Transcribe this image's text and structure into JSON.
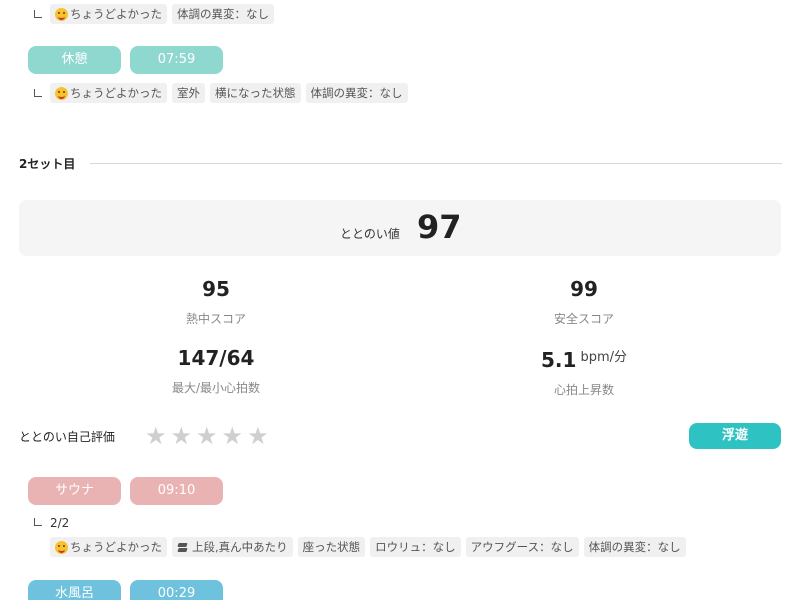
{
  "set1": {
    "row_top_tags": [
      "ちょうどよかった",
      "体調の異変：なし"
    ],
    "rest": {
      "label": "休憩",
      "time": "07:59",
      "tags": [
        "ちょうどよかった",
        "室外",
        "横になった状態",
        "体調の異変：なし"
      ]
    }
  },
  "set2": {
    "title": "2セット目",
    "totonoi": {
      "label": "ととのい値",
      "value": "97"
    },
    "metrics": {
      "heat_score": {
        "value": "95",
        "label": "熱中スコア"
      },
      "safety_score": {
        "value": "99",
        "label": "安全スコア"
      },
      "heart_rate": {
        "value": "147/64",
        "label": "最大/最小心拍数"
      },
      "hr_rise": {
        "value": "5.1",
        "unit": "bpm/分",
        "label": "心拍上昇数"
      }
    },
    "self_eval": {
      "label": "ととのい自己評価",
      "stars_total": 5,
      "stars_filled": 0
    },
    "status_button": "浮遊",
    "sauna": {
      "label": "サウナ",
      "time": "09:10",
      "set_count": "2/2",
      "tags": [
        "ちょうどよかった",
        "上段,真ん中あたり",
        "座った状態",
        "ロウリュ：なし",
        "アウフグース：なし",
        "体調の異変：なし"
      ]
    },
    "cold_bath": {
      "label": "水風呂",
      "time": "00:29"
    }
  },
  "colors": {
    "rest_pill": "#8fd8cf",
    "sauna_pill": "#eab3b3",
    "cold_pill": "#6fc2de",
    "status_button": "#2fc2c2"
  }
}
